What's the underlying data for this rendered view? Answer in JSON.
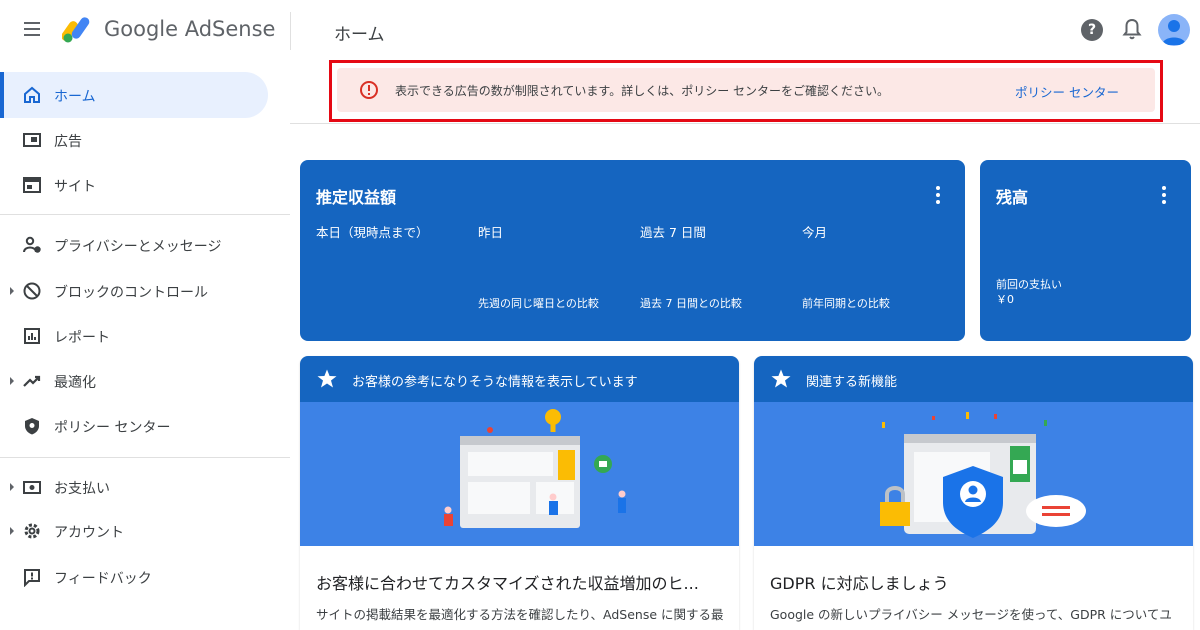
{
  "app": {
    "brand": "Google AdSense",
    "page_title": "ホーム",
    "help_glyph": "?"
  },
  "sidebar": {
    "items": [
      {
        "label": "ホーム",
        "icon": "home-icon",
        "active": true
      },
      {
        "label": "広告",
        "icon": "ads-icon"
      },
      {
        "label": "サイト",
        "icon": "sites-icon"
      },
      {
        "label": "プライバシーとメッセージ",
        "icon": "privacy-icon"
      },
      {
        "label": "ブロックのコントロール",
        "icon": "block-icon"
      },
      {
        "label": "レポート",
        "icon": "report-icon"
      },
      {
        "label": "最適化",
        "icon": "optimize-icon"
      },
      {
        "label": "ポリシー センター",
        "icon": "policy-icon"
      },
      {
        "label": "お支払い",
        "icon": "payments-icon"
      },
      {
        "label": "アカウント",
        "icon": "account-icon"
      },
      {
        "label": "フィードバック",
        "icon": "feedback-icon"
      }
    ]
  },
  "alert": {
    "text": "表示できる広告の数が制限されています。詳しくは、ポリシー センターをご確認ください。",
    "link": "ポリシー センター"
  },
  "earnings": {
    "title": "推定収益額",
    "columns": [
      "本日（現時点まで）",
      "昨日",
      "過去 7 日間",
      "今月"
    ],
    "comparisons": [
      "先週の同じ曜日との比較",
      "過去 7 日間との比較",
      "前年同期との比較"
    ]
  },
  "balance": {
    "title": "残高",
    "last_payment_label": "前回の支払い",
    "last_payment_value": "￥0"
  },
  "panels": [
    {
      "header": "お客様の参考になりそうな情報を表示しています",
      "title": "お客様に合わせてカスタマイズされた収益増加のヒ...",
      "desc": "サイトの掲載結果を最適化する方法を確認したり、AdSense に関する最新情報を入手したりできます。"
    },
    {
      "header": "関連する新機能",
      "title": "GDPR に対応しましょう",
      "desc": "Google の新しいプライバシー メッセージを使って、GDPR についてユーザーの同意を取得することができます。"
    }
  ],
  "colors": {
    "primary": "#1565c0",
    "accent": "#1967d2",
    "alert_bg": "#fce8e6",
    "alert_red": "#d93025",
    "highlight_frame": "#e50914"
  }
}
